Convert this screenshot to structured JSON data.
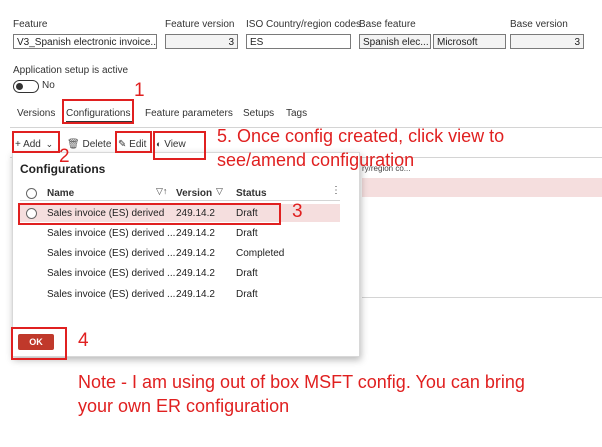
{
  "fields": {
    "feature_label": "Feature",
    "feature_value": "V3_Spanish electronic invoice...",
    "feature_version_label": "Feature version",
    "feature_version_value": "3",
    "iso_label": "ISO Country/region codes",
    "iso_value": "ES",
    "base_feature_label": "Base feature",
    "base_feature_value1": "Spanish elec...",
    "base_feature_value2": "Microsoft",
    "base_version_label": "Base version",
    "base_version_value": "3"
  },
  "app_setup": {
    "label": "Application setup is active",
    "toggle_text": "No"
  },
  "tabs": [
    "Versions",
    "Configurations",
    "Feature parameters",
    "Setups",
    "Tags"
  ],
  "actions": {
    "add": "+ Add",
    "delete": "Delete",
    "edit": "Edit",
    "view": "View"
  },
  "panel": {
    "title": "Configurations",
    "columns": {
      "name": "Name",
      "version": "Version",
      "status": "Status"
    },
    "rows": [
      {
        "name": "Sales invoice (ES) derived",
        "version": "249.14.2",
        "status": "Draft"
      },
      {
        "name": "Sales invoice (ES) derived ...",
        "version": "249.14.2",
        "status": "Draft"
      },
      {
        "name": "Sales invoice (ES) derived ...",
        "version": "249.14.2",
        "status": "Completed"
      },
      {
        "name": "Sales invoice (ES) derived ...",
        "version": "249.14.2",
        "status": "Draft"
      },
      {
        "name": "Sales invoice (ES) derived ...",
        "version": "249.14.2",
        "status": "Draft"
      }
    ],
    "ok_label": "OK"
  },
  "bg_column_fragment": "ry/region co...",
  "annotations": {
    "n1": "1",
    "n2": "2",
    "n3": "3",
    "n4": "4",
    "step5": "5. Once config created, click view to see/amend configuration",
    "note": "Note - I am using out of box MSFT config. You can bring your own ER configuration"
  },
  "colors": {
    "annotation": "#e02020",
    "selected_row": "#f5dede",
    "ok_button": "#c0392b"
  }
}
